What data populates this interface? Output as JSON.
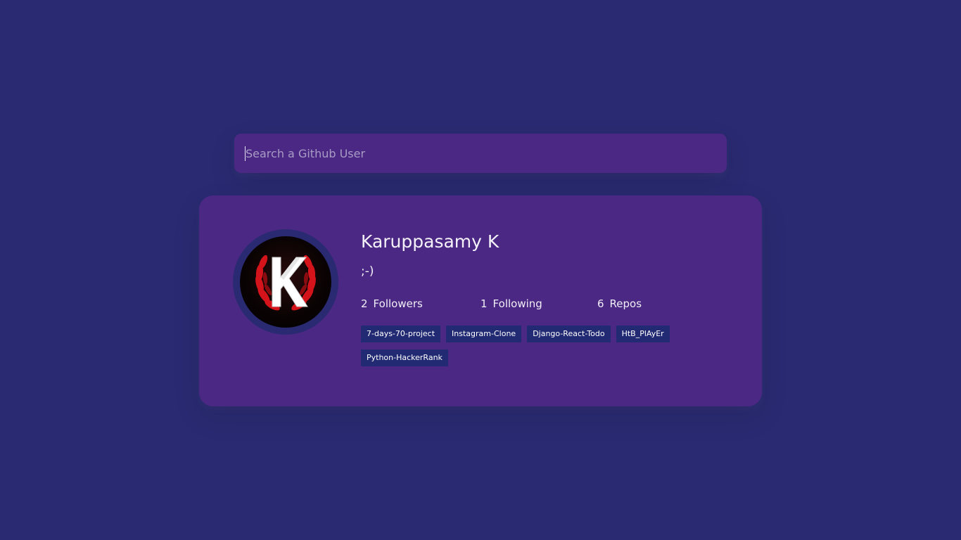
{
  "search": {
    "placeholder": "Search a Github User",
    "value": ""
  },
  "profile": {
    "avatar_icon": "k-emblem-avatar-icon",
    "name": "Karuppasamy K",
    "bio": ";-)",
    "stats": {
      "followers": {
        "count": "2",
        "label": "Followers"
      },
      "following": {
        "count": "1",
        "label": "Following"
      },
      "repos": {
        "count": "6",
        "label": "Repos"
      }
    },
    "repos": [
      "7-days-70-project",
      "Instagram-Clone",
      "Django-React-Todo",
      "HtB_PlAyEr",
      "Python-HackerRank"
    ]
  },
  "colors": {
    "page_background": "#2a2a72",
    "card_background": "#4c2885",
    "repo_tag_background": "#212a72",
    "text": "#f0f0f5"
  }
}
